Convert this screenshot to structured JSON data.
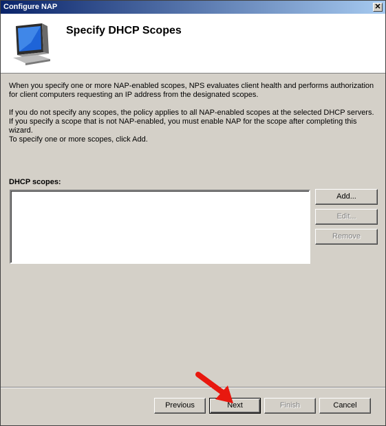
{
  "window": {
    "title": "Configure NAP",
    "close_glyph": "✕"
  },
  "header": {
    "heading": "Specify DHCP Scopes",
    "icon": "monitor-icon"
  },
  "description": {
    "p1": "When you specify one or more NAP-enabled scopes, NPS evaluates client health and performs authorization for client computers requesting an IP address from the designated scopes.",
    "p2": "If you do not specify any scopes, the policy applies to all NAP-enabled scopes at the selected DHCP servers. If you specify a scope that is not NAP-enabled, you must enable NAP for the scope after completing this wizard.",
    "p3": "To specify one or more scopes, click Add."
  },
  "scopes": {
    "label": "DHCP scopes:",
    "items": []
  },
  "buttons": {
    "add": "Add...",
    "edit": "Edit...",
    "remove": "Remove",
    "previous": "Previous",
    "next": "Next",
    "finish": "Finish",
    "cancel": "Cancel"
  },
  "colors": {
    "arrow": "#e8180f",
    "title_bar_start": "#0a246a",
    "title_bar_end": "#a6caf0",
    "dialog_bg": "#d4d0c8"
  }
}
